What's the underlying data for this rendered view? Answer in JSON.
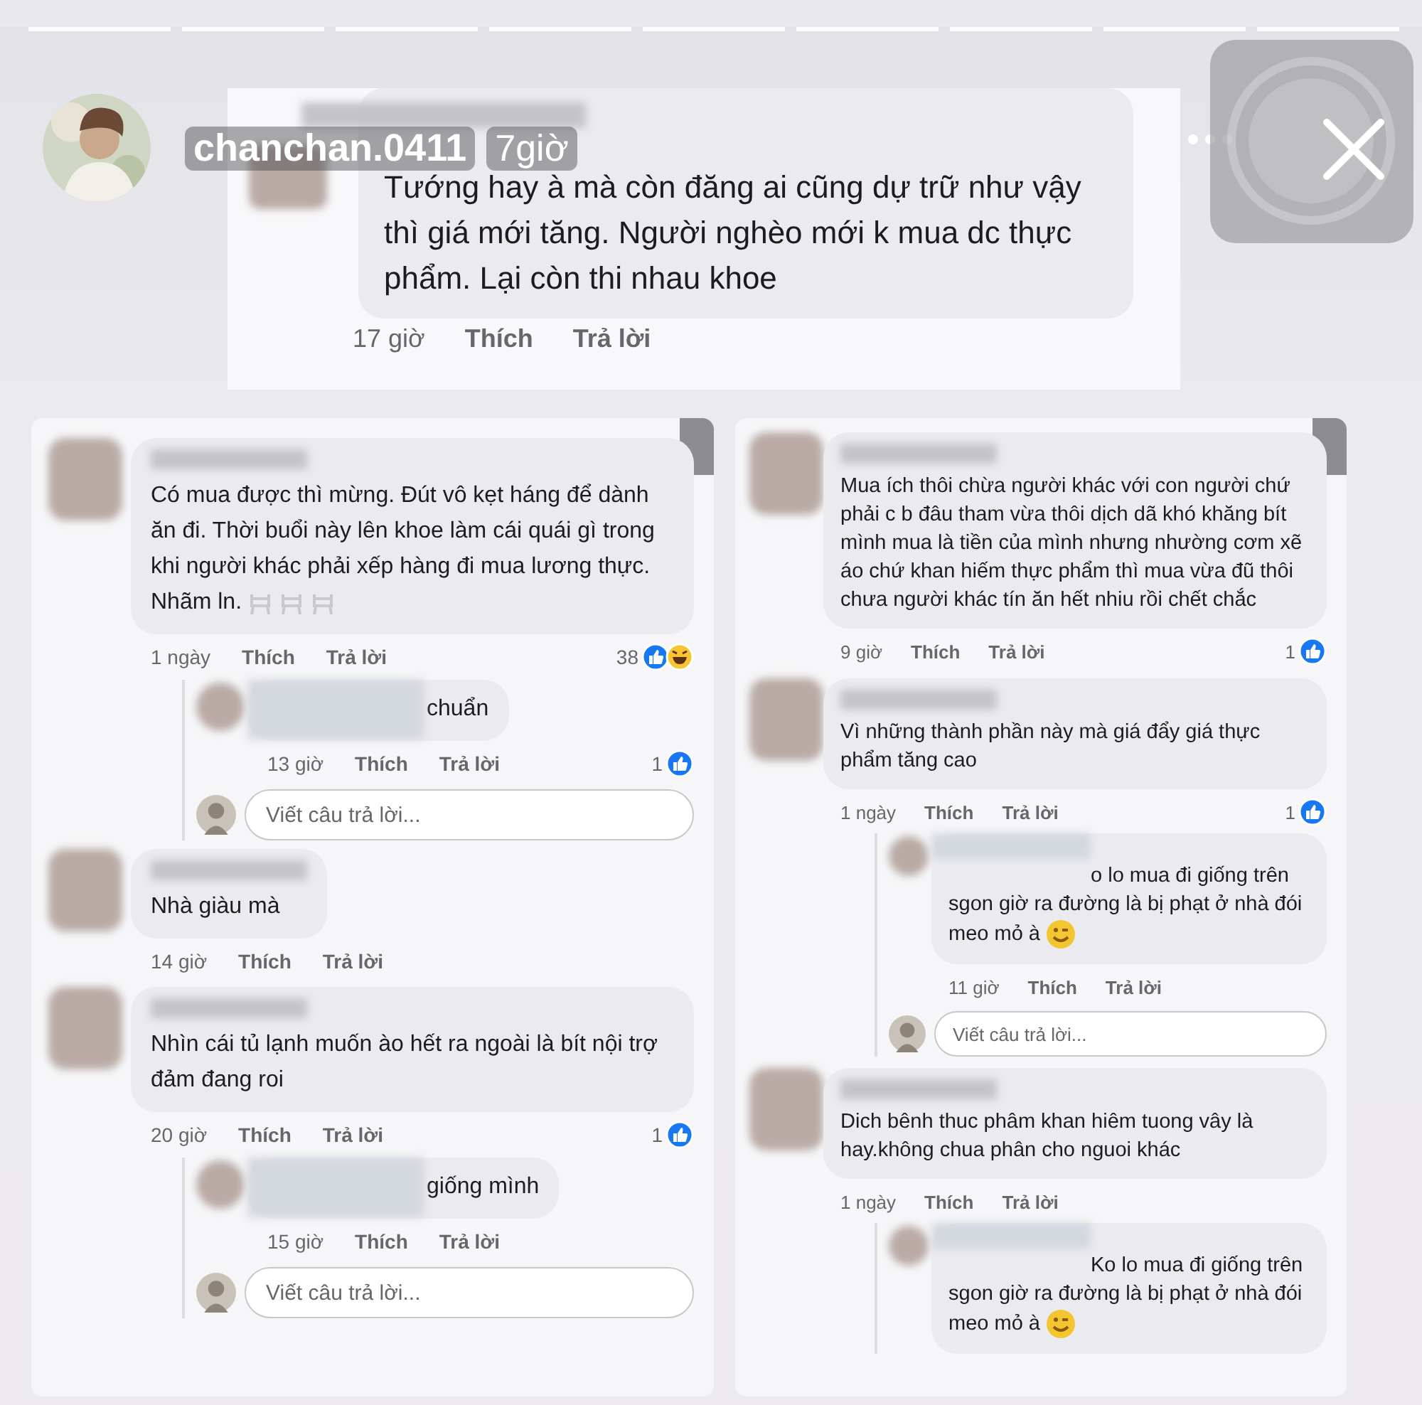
{
  "header": {
    "username": "chanchan.0411",
    "time": "7giờ"
  },
  "top_comment": {
    "text": "Tướng hay à mà còn đăng ai cũng dự trữ như vậy thì giá mới tăng. Người nghèo mới k mua dc thực phẩm. Lại còn thi nhau khoe",
    "time": "17 giờ",
    "like": "Thích",
    "reply": "Trả lời"
  },
  "panels": [
    {
      "threads": [
        {
          "text": "Có mua được thì mừng. Đút vô kẹt háng để dành ăn đi. Thời buổi này lên khoe làm cái quái gì trong khi người khác phải xếp hàng đi mua lương thực. Nhãm ln.",
          "emoji": [
            {
              "kind": "faint"
            },
            {
              "kind": "faint"
            },
            {
              "kind": "faint"
            }
          ],
          "time": "1 ngày",
          "like": "Thích",
          "reply": "Trả lời",
          "reactions": {
            "count": "38",
            "icons": [
              {
                "kind": "like"
              },
              {
                "kind": "haha"
              }
            ]
          },
          "children": [
            {
              "text": "chuẩn",
              "time": "13 giờ",
              "like": "Thích",
              "reply": "Trả lời",
              "reactions": {
                "count": "1",
                "icons": [
                  {
                    "kind": "like"
                  }
                ]
              }
            }
          ],
          "reply_box": {
            "placeholder": "Viết câu trả lời..."
          }
        },
        {
          "text": "Nhà giàu mà",
          "time": "14 giờ",
          "like": "Thích",
          "reply": "Trả lời"
        },
        {
          "text": "Nhìn cái tủ lạnh muốn ào hết ra ngoài là bít nội trợ đảm đang roi",
          "time": "20 giờ",
          "like": "Thích",
          "reply": "Trả lời",
          "reactions": {
            "count": "1",
            "icons": [
              {
                "kind": "like"
              }
            ]
          },
          "children": [
            {
              "text": "giống mình",
              "time": "15 giờ",
              "like": "Thích",
              "reply": "Trả lời"
            }
          ],
          "reply_box": {
            "placeholder": "Viết câu trả lời..."
          }
        }
      ]
    },
    {
      "threads": [
        {
          "text": "Mua ích thôi chừa người khác với con người chứ phải c b đâu tham vừa thôi dịch dã khó khăng bít mình mua là tiền của mình nhưng nhường cơm xẽ áo chứ  khan hiếm thực phẩm thì mua vừa đũ thôi chưa người khác tín ăn hết nhiu rồi chết chắc",
          "time": "9 giờ",
          "like": "Thích",
          "reply": "Trả lời",
          "reactions": {
            "count": "1",
            "icons": [
              {
                "kind": "like"
              }
            ]
          }
        },
        {
          "text": "Vì những thành phần này mà giá đẩy giá thực phẩm tăng cao",
          "time": "1 ngày",
          "like": "Thích",
          "reply": "Trả lời",
          "reactions": {
            "count": "1",
            "icons": [
              {
                "kind": "like"
              }
            ]
          },
          "children": [
            {
              "text": "o lo mua đi giống trên sgon giờ ra đường là bị phạt ở nhà đói meo mỏ à",
              "emoji": [
                {
                  "kind": "wink"
                }
              ],
              "time": "11 giờ",
              "like": "Thích",
              "reply": "Trả lời"
            }
          ],
          "reply_box": {
            "placeholder": "Viết câu trả lời..."
          }
        },
        {
          "text": "Dich bênh thuc phâm khan hiêm tuong vây là hay.không chua phân cho nguoi khác",
          "time": "1 ngày",
          "like": "Thích",
          "reply": "Trả lời",
          "children": [
            {
              "text": "Ko lo mua đi giống trên sgon giờ ra đường là bị phạt ở nhà đói meo mỏ à",
              "emoji": [
                {
                  "kind": "wink"
                }
              ]
            }
          ]
        }
      ]
    }
  ]
}
